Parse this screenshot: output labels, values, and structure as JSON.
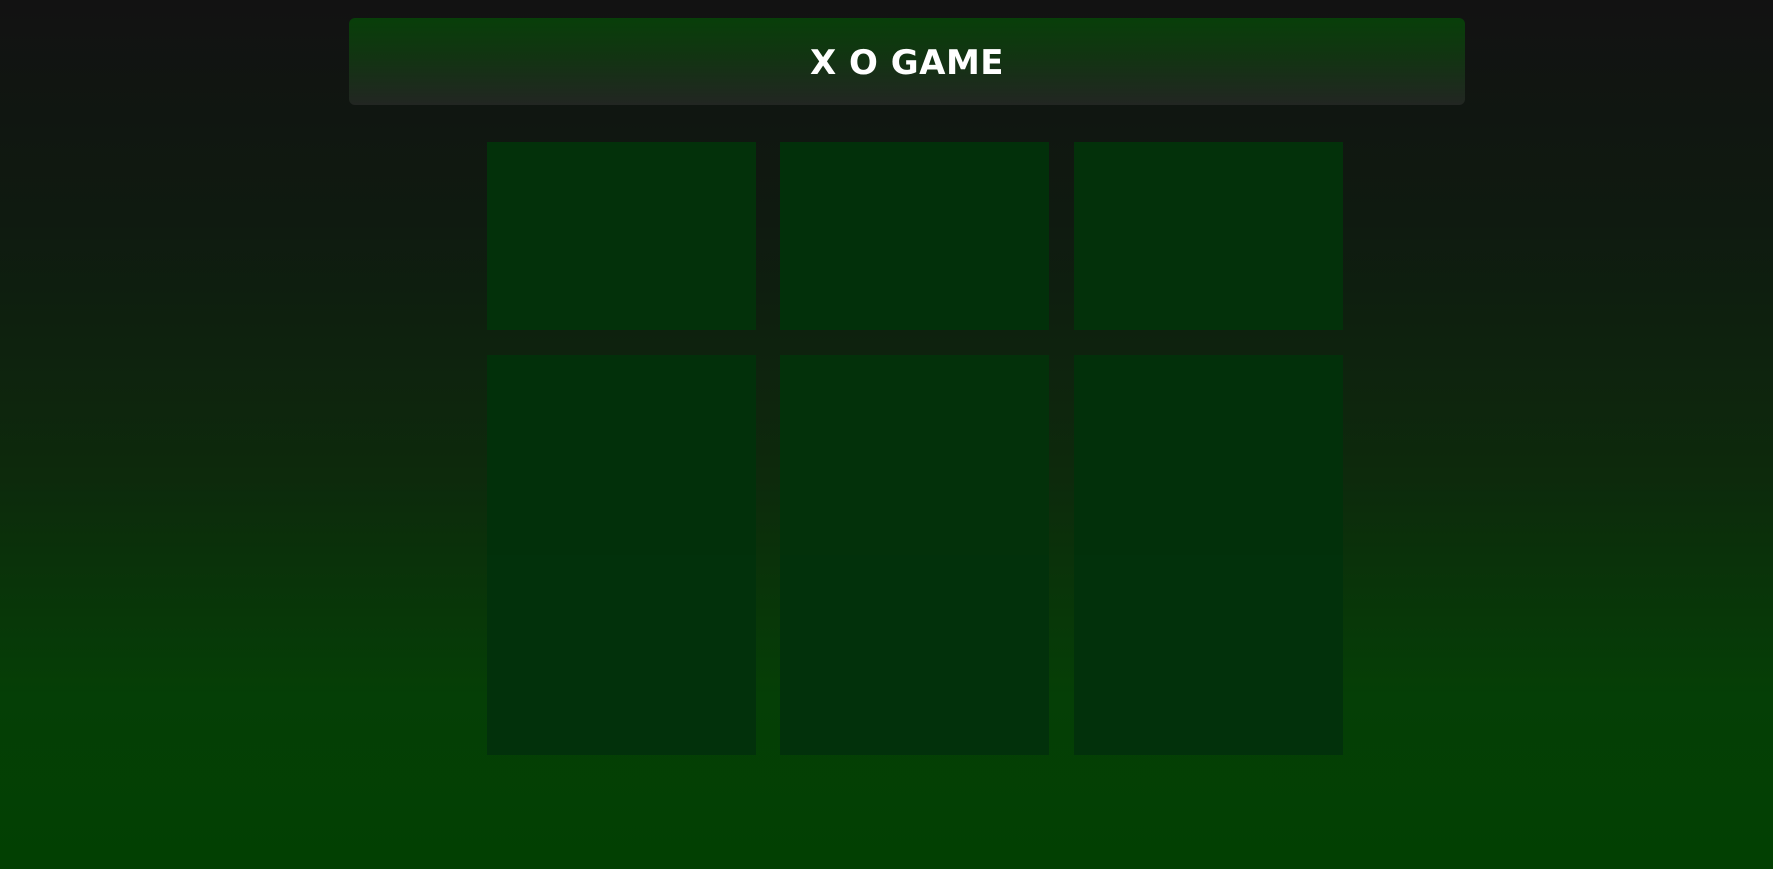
{
  "header": {
    "title": "X O GAME"
  },
  "board": {
    "rows": 3,
    "cols": 3,
    "cells": [
      "",
      "",
      "",
      "",
      "",
      "",
      "",
      "",
      ""
    ]
  },
  "colors": {
    "background_top": "#121212",
    "background_bottom": "#024002",
    "header_top": "#083f09",
    "header_bottom": "#222622",
    "cell": "#02300a",
    "title_text": "#ffffff"
  }
}
